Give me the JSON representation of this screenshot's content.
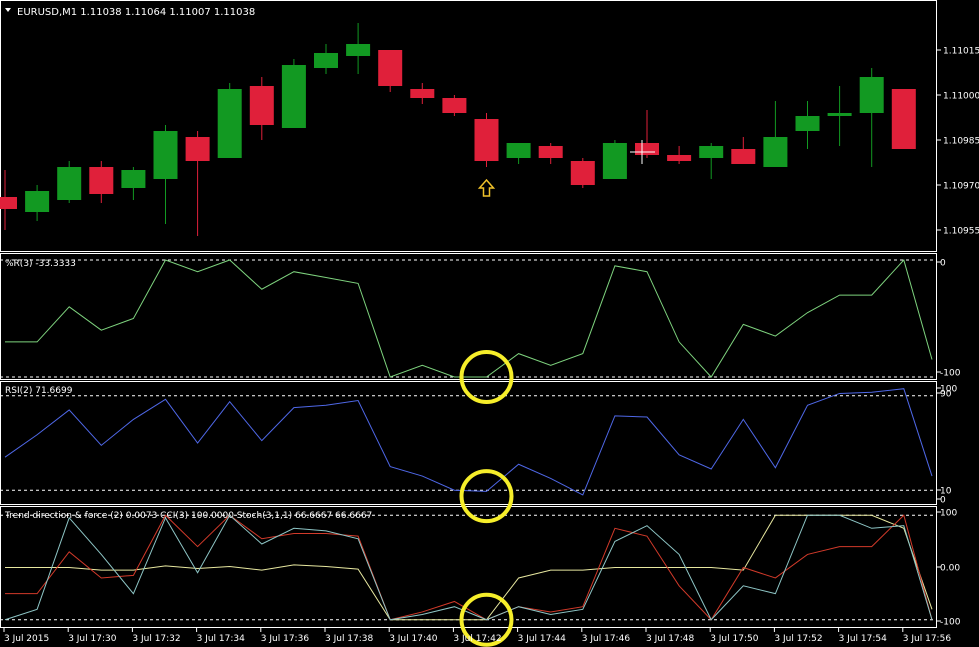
{
  "header": {
    "label": "EURUSD,M1  1.11038 1.11064 1.11007 1.11038"
  },
  "colors": {
    "bull": "#129922",
    "bear": "#e0203a",
    "wr": "#7ed37e",
    "rsi": "#4f68e8",
    "tdf": "#e8e8a0",
    "cci": "#d23a2a",
    "stoch": "#8ec6c6",
    "annotation": "#f6ee2a",
    "arrow": "#f0c22a",
    "frame": "#ffffff"
  },
  "chart_data": [
    {
      "type": "candlestick",
      "title": "EURUSD,M1  1.11038 1.11064 1.11007 1.11038",
      "y_ticks": [
        "1.11015",
        "1.11000",
        "1.10985",
        "1.10970",
        "1.10955"
      ],
      "ylim": [
        1.1095,
        1.11025
      ],
      "ohlc": [
        {
          "o": 1.10966,
          "h": 1.10975,
          "l": 1.10955,
          "c": 1.10962
        },
        {
          "o": 1.10961,
          "h": 1.1097,
          "l": 1.10958,
          "c": 1.10968
        },
        {
          "o": 1.10965,
          "h": 1.10978,
          "l": 1.10964,
          "c": 1.10976
        },
        {
          "o": 1.10976,
          "h": 1.10978,
          "l": 1.10964,
          "c": 1.10967
        },
        {
          "o": 1.10969,
          "h": 1.10976,
          "l": 1.10965,
          "c": 1.10975
        },
        {
          "o": 1.10972,
          "h": 1.1099,
          "l": 1.10957,
          "c": 1.10988
        },
        {
          "o": 1.10986,
          "h": 1.10988,
          "l": 1.10953,
          "c": 1.10978
        },
        {
          "o": 1.10979,
          "h": 1.11004,
          "l": 1.10979,
          "c": 1.11002
        },
        {
          "o": 1.11003,
          "h": 1.11006,
          "l": 1.10985,
          "c": 1.1099
        },
        {
          "o": 1.10989,
          "h": 1.11012,
          "l": 1.10989,
          "c": 1.1101
        },
        {
          "o": 1.11009,
          "h": 1.11017,
          "l": 1.11007,
          "c": 1.11014
        },
        {
          "o": 1.11013,
          "h": 1.11024,
          "l": 1.11007,
          "c": 1.11017
        },
        {
          "o": 1.11015,
          "h": 1.11015,
          "l": 1.11001,
          "c": 1.11003
        },
        {
          "o": 1.11002,
          "h": 1.11004,
          "l": 1.10997,
          "c": 1.10999
        },
        {
          "o": 1.10999,
          "h": 1.11,
          "l": 1.10993,
          "c": 1.10994
        },
        {
          "o": 1.10992,
          "h": 1.10994,
          "l": 1.10976,
          "c": 1.10978
        },
        {
          "o": 1.10979,
          "h": 1.10984,
          "l": 1.10977,
          "c": 1.10984
        },
        {
          "o": 1.10983,
          "h": 1.10984,
          "l": 1.10977,
          "c": 1.10979
        },
        {
          "o": 1.10978,
          "h": 1.10979,
          "l": 1.10969,
          "c": 1.1097
        },
        {
          "o": 1.10972,
          "h": 1.10985,
          "l": 1.10972,
          "c": 1.10984
        },
        {
          "o": 1.10984,
          "h": 1.10995,
          "l": 1.10979,
          "c": 1.1098
        },
        {
          "o": 1.1098,
          "h": 1.10983,
          "l": 1.10977,
          "c": 1.10978
        },
        {
          "o": 1.10979,
          "h": 1.10984,
          "l": 1.10972,
          "c": 1.10983
        },
        {
          "o": 1.10982,
          "h": 1.10986,
          "l": 1.10977,
          "c": 1.10977
        },
        {
          "o": 1.10976,
          "h": 1.10998,
          "l": 1.10976,
          "c": 1.10986
        },
        {
          "o": 1.10988,
          "h": 1.10998,
          "l": 1.10982,
          "c": 1.10993
        },
        {
          "o": 1.10993,
          "h": 1.11003,
          "l": 1.10983,
          "c": 1.10994
        },
        {
          "o": 1.10994,
          "h": 1.11009,
          "l": 1.10976,
          "c": 1.11006
        },
        {
          "o": 1.11002,
          "h": 1.11002,
          "l": 1.10983,
          "c": 1.10982
        }
      ]
    },
    {
      "type": "line",
      "title": "%R(3) -33.3333",
      "ylim": [
        -100,
        0
      ],
      "y_ticks": [
        "0",
        "-100"
      ],
      "series": [
        {
          "name": "%R(3)",
          "values": [
            -70,
            -70,
            -40,
            -60,
            -50,
            0,
            -10,
            0,
            -25,
            -10,
            -15,
            -20,
            -100,
            -90,
            -100,
            -100,
            -80,
            -90,
            -80,
            -5,
            -10,
            -70,
            -100,
            -55,
            -65,
            -45,
            -30,
            -30,
            0,
            -85
          ]
        }
      ]
    },
    {
      "type": "line",
      "title": "RSI(2) 71.6699",
      "ylim": [
        0,
        100
      ],
      "y_ticks": [
        "100",
        "90",
        "10",
        "0"
      ],
      "series": [
        {
          "name": "RSI(2)",
          "values": [
            38,
            57,
            78,
            48,
            70,
            87,
            50,
            85,
            52,
            80,
            82,
            86,
            30,
            22,
            10,
            9,
            32,
            20,
            6,
            73,
            72,
            40,
            28,
            70,
            29,
            82,
            92,
            93,
            96,
            22
          ]
        }
      ]
    },
    {
      "type": "line",
      "title": "Trend direction & force (2) 0.0073  CCI(3) 100.0000  Stoch(3,1,1) 66.6667 66.6667",
      "ylim": [
        -110,
        110
      ],
      "y_ticks": [
        "100",
        "0.00",
        "-100"
      ],
      "series": [
        {
          "name": "Trend direction & force (2)",
          "values": [
            0,
            0,
            0,
            -5,
            -5,
            3,
            -2,
            2,
            -5,
            5,
            2,
            -3,
            -100,
            -100,
            -100,
            -100,
            -20,
            -5,
            -5,
            0,
            0,
            0,
            0,
            -5,
            100,
            100,
            100,
            100,
            75,
            -80
          ]
        },
        {
          "name": "CCI(3)",
          "values": [
            -50,
            -50,
            30,
            -20,
            -15,
            100,
            40,
            100,
            55,
            65,
            65,
            60,
            -100,
            -85,
            -65,
            -100,
            -75,
            -85,
            -75,
            75,
            60,
            -35,
            -100,
            0,
            -20,
            25,
            40,
            40,
            100,
            -100
          ]
        },
        {
          "name": "Stoch(3,1,1)",
          "values": [
            -100,
            -80,
            95,
            25,
            -50,
            95,
            -10,
            100,
            45,
            75,
            70,
            55,
            -100,
            -90,
            -75,
            -100,
            -75,
            -90,
            -80,
            50,
            80,
            25,
            -100,
            -35,
            -50,
            100,
            100,
            75,
            80,
            -100
          ]
        }
      ]
    }
  ],
  "x_axis": {
    "labels": [
      "3 Jul 2015",
      "3 Jul 17:30",
      "3 Jul 17:32",
      "3 Jul 17:34",
      "3 Jul 17:36",
      "3 Jul 17:38",
      "3 Jul 17:40",
      "3 Jul 17:42",
      "3 Jul 17:44",
      "3 Jul 17:46",
      "3 Jul 17:48",
      "3 Jul 17:50",
      "3 Jul 17:52",
      "3 Jul 17:54",
      "3 Jul 17:56"
    ]
  },
  "annotations": [
    {
      "type": "up-arrow",
      "bar": 15
    },
    {
      "type": "circle",
      "panel": 1,
      "bar": 15,
      "value": -100
    },
    {
      "type": "circle",
      "panel": 2,
      "bar": 15,
      "value": 5
    },
    {
      "type": "circle",
      "panel": 3,
      "bar": 15,
      "value": -100
    }
  ]
}
